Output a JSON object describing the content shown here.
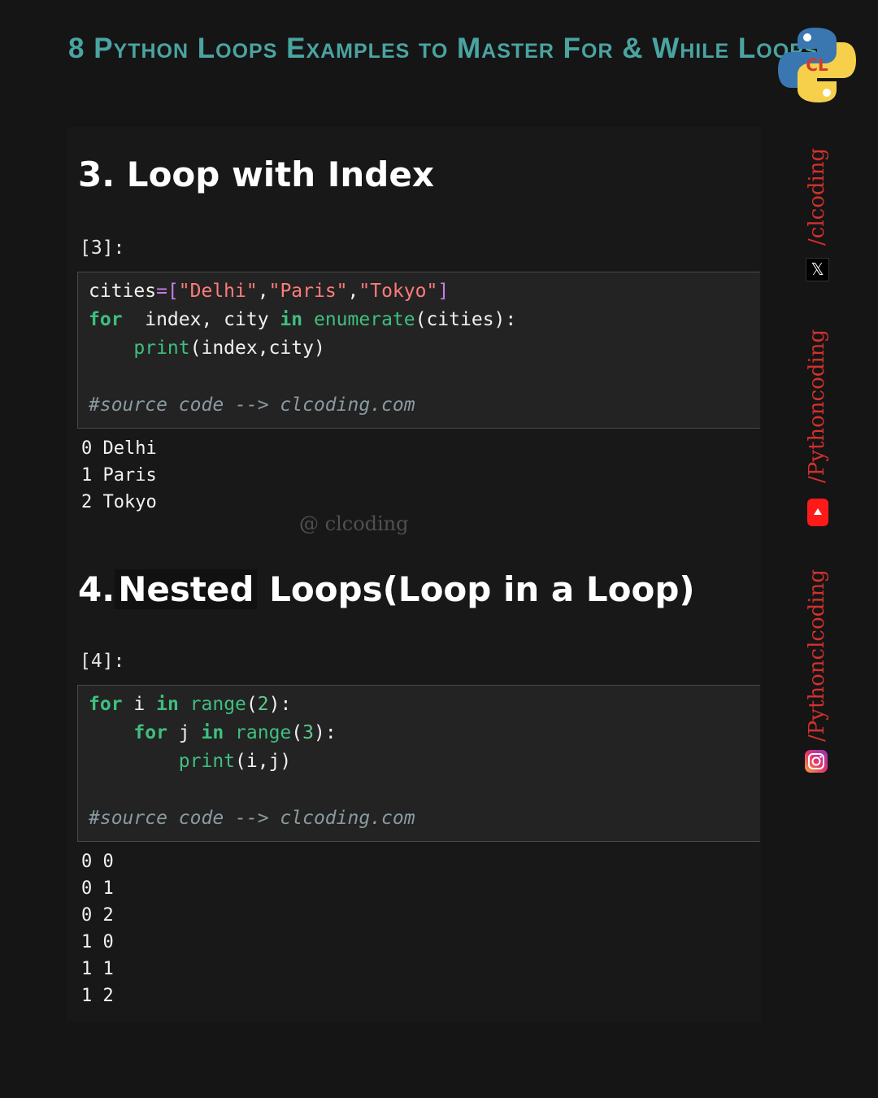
{
  "header": {
    "title": "8 Python Loops Examples to Master For & While Loops"
  },
  "section3": {
    "heading": "3. Loop with Index",
    "prompt": "[3]:",
    "code": {
      "l1_var": "cities",
      "l1_op": "=[",
      "l1_s1": "\"Delhi\"",
      "l1_c1": ",",
      "l1_s2": "\"Paris\"",
      "l1_c2": ",",
      "l1_s3": "\"Tokyo\"",
      "l1_end": "]",
      "l2_for": "for",
      "l2_mid": "  index, city ",
      "l2_in": "in",
      "l2_fn": "enumerate",
      "l2_end": "(cities):",
      "l3_fn": "print",
      "l3_end": "(index,city)",
      "comment": "#source code --> clcoding.com"
    },
    "output": [
      "0 Delhi",
      "1 Paris",
      "2 Tokyo"
    ]
  },
  "watermark": "@ clcoding",
  "section4": {
    "heading_num": "4.",
    "heading_nested": "Nested",
    "heading_rest": " Loops(Loop in a Loop)",
    "prompt": "[4]:",
    "code": {
      "l1_for": "for",
      "l1_var": " i ",
      "l1_in": "in",
      "l1_fn": "range",
      "l1_p1": "(",
      "l1_num": "2",
      "l1_p2": "):",
      "l2_for": "for",
      "l2_var": " j ",
      "l2_in": "in",
      "l2_fn": "range",
      "l2_p1": "(",
      "l2_num": "3",
      "l2_p2": "):",
      "l3_fn": "print",
      "l3_end": "(i,j)",
      "comment": "#source code --> clcoding.com"
    },
    "output": [
      "0 0",
      "0 1",
      "0 2",
      "1 0",
      "1 1",
      "1 2"
    ]
  },
  "social": {
    "x_handle": "/clcoding",
    "x_icon_glyph": "𝕏",
    "youtube_handle": "/Pythoncoding",
    "instagram_handle": "/Pythonclcoding"
  },
  "colors": {
    "title": "#4aa4a1",
    "keyword": "#3fbf7f",
    "string": "#ff7b7b",
    "social": "#d2312d"
  }
}
